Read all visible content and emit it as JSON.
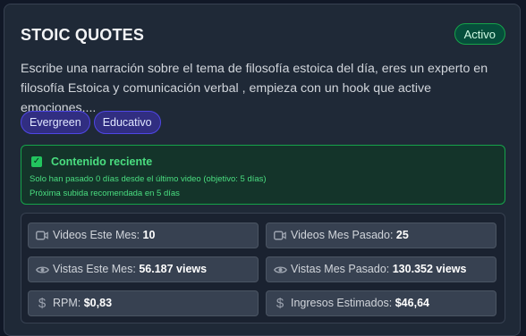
{
  "header": {
    "title": "STOIC QUOTES",
    "status": "Activo"
  },
  "description": "Escribe una narración sobre el tema de filosofía estoica del día, eres un experto en filosofía Estoica y comunicación verbal , empieza con un hook que active emociones....",
  "tags": [
    "Evergreen",
    "Educativo"
  ],
  "alert": {
    "title": "Contenido reciente",
    "line1": "Solo han pasado 0 días desde el último video (objetivo: 5 días)",
    "line2": "Próxima subida recomendada en 5 días"
  },
  "stats": [
    {
      "icon": "video-icon",
      "label": "Videos Este Mes:",
      "value": "10"
    },
    {
      "icon": "video-icon",
      "label": "Videos Mes Pasado:",
      "value": "25"
    },
    {
      "icon": "eye-icon",
      "label": "Vistas Este Mes:",
      "value": "56.187 views"
    },
    {
      "icon": "eye-icon",
      "label": "Vistas Mes Pasado:",
      "value": "130.352 views"
    },
    {
      "icon": "dollar-icon",
      "label": "RPM:",
      "value": "$0,83"
    },
    {
      "icon": "dollar-icon",
      "label": "Ingresos Estimados:",
      "value": "$46,64"
    }
  ],
  "colors": {
    "accent_green": "#22c55e",
    "tag_bg": "#312e81",
    "card_bg": "#1f2937"
  }
}
